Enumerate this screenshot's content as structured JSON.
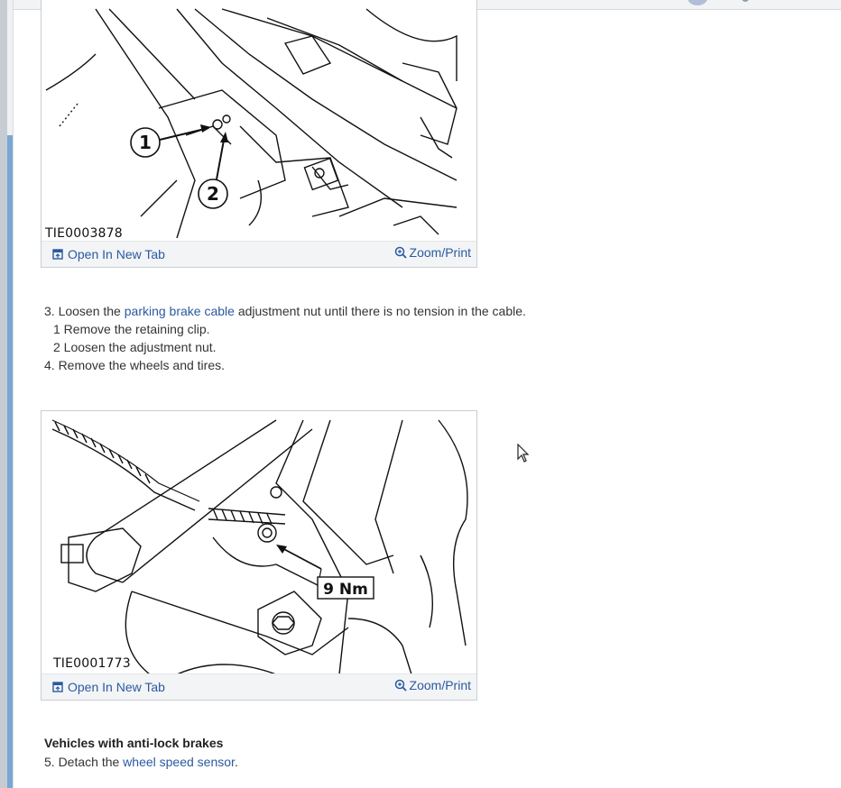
{
  "figures": [
    {
      "id_label": "TIE0003878",
      "callouts": [
        "1",
        "2"
      ],
      "open_tab_label": "Open In New Tab",
      "zoom_label": "Zoom/Print"
    },
    {
      "id_label": "TIE0001773",
      "torque_label": "9 Nm",
      "open_tab_label": "Open In New Tab",
      "zoom_label": "Zoom/Print"
    }
  ],
  "steps": {
    "step3": {
      "prefix": "3. Loosen the ",
      "link": "parking brake cable",
      "suffix": " adjustment nut until there is no tension in the cable.",
      "sub": [
        "1  Remove the retaining clip.",
        "2  Loosen the adjustment nut."
      ]
    },
    "step4": "4. Remove the wheels and tires.",
    "section_heading": "Vehicles with anti-lock brakes",
    "step5": {
      "prefix": "5. Detach the ",
      "link": "wheel speed sensor",
      "suffix": "."
    }
  },
  "colors": {
    "link": "#2a5aa0",
    "text": "#333333",
    "bar_bg": "#f3f4f6"
  }
}
